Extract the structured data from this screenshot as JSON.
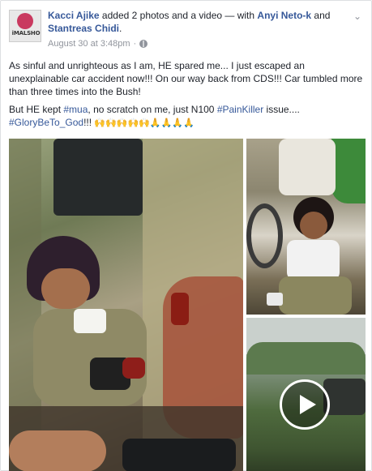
{
  "post": {
    "author": "Kacci Ajike",
    "action_text": " added 2 photos and a video — with ",
    "tagged_1": "Anyi Neto-k",
    "and_text": " and ",
    "tagged_2": "Stantreas Chidi",
    "period": ".",
    "timestamp": "August 30 at 3:48pm",
    "separator": "·",
    "avatar_text": "iMALSHO",
    "chevron": "⌄",
    "paragraph_1": "As sinful and unrighteous as I am, HE spared me... I just escaped an unexplainable car accident now!!! On our way back from CDS!!! Car tumbled more than three times into the Bush!",
    "p2_text_1": "But HE kept ",
    "p2_tag_1": "#mua",
    "p2_text_2": ", no scratch on me, just N100 ",
    "p2_tag_2": "#PainKiller",
    "p2_text_3": " issue....",
    "p2_tag_3": "#GloryBeTo_God",
    "p2_text_4": "!!! ",
    "emojis": "🙌🙌🙌🙌🙌🙏🙏🙏🙏"
  },
  "media": {
    "photo_1": "accident-photo-1",
    "photo_2": "accident-photo-2",
    "video": "accident-video",
    "play_icon": "play-icon"
  },
  "colors": {
    "link": "#365899",
    "meta": "#90949c",
    "text": "#1d2129"
  }
}
